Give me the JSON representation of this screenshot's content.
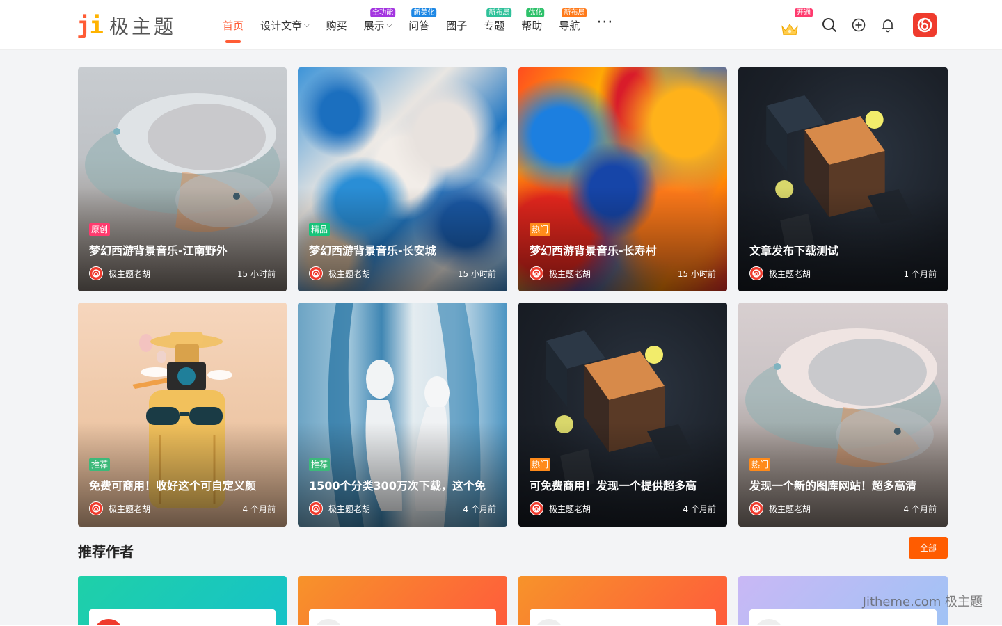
{
  "logo": {
    "mark_j": "j",
    "mark_i": "i",
    "text": "极主题"
  },
  "nav": {
    "items": [
      {
        "label": "首页",
        "active": true,
        "badge": "",
        "badge_color": ""
      },
      {
        "label": "设计文章",
        "active": false,
        "badge": "",
        "badge_color": "",
        "dropdown": true
      },
      {
        "label": "购买",
        "active": false,
        "badge": "",
        "badge_color": ""
      },
      {
        "label": "展示",
        "active": false,
        "badge": "全功能",
        "badge_color": "#a335e0",
        "dropdown": true
      },
      {
        "label": "问答",
        "active": false,
        "badge": "新美化",
        "badge_color": "#1e88e5"
      },
      {
        "label": "圈子",
        "active": false,
        "badge": "",
        "badge_color": ""
      },
      {
        "label": "专题",
        "active": false,
        "badge": "新布局",
        "badge_color": "#2ec19a"
      },
      {
        "label": "帮助",
        "active": false,
        "badge": "优化",
        "badge_color": "#2ec16a"
      },
      {
        "label": "导航",
        "active": false,
        "badge": "新布局",
        "badge_color": "#ff7a1a"
      }
    ],
    "more": "···"
  },
  "header_right": {
    "vip_badge": "开通"
  },
  "posts": [
    {
      "tag": "原创",
      "tag_color": "#ff3a6e",
      "title": "梦幻西游背景音乐-江南野外",
      "author": "极主题老胡",
      "time": "15 小时前",
      "img": "dome"
    },
    {
      "tag": "精品",
      "tag_color": "#17c37a",
      "title": "梦幻西游背景音乐-长安城",
      "author": "极主题老胡",
      "time": "15 小时前",
      "img": "marble"
    },
    {
      "tag": "热门",
      "tag_color": "#ff8a1a",
      "title": "梦幻西游背景音乐-长寿村",
      "author": "极主题老胡",
      "time": "15 小时前",
      "img": "fluid"
    },
    {
      "tag": "",
      "tag_color": "",
      "title": "文章发布下载测试",
      "author": "极主题老胡",
      "time": "1 个月前",
      "img": "cubes"
    },
    {
      "tag": "推荐",
      "tag_color": "#3cb97a",
      "title": "免费可商用！收好这个可自定义颜",
      "author": "极主题老胡",
      "time": "4 个月前",
      "img": "luggage"
    },
    {
      "tag": "推荐",
      "tag_color": "#3cb97a",
      "title": "1500个分类300万次下载，这个免",
      "author": "极主题老胡",
      "time": "4 个月前",
      "img": "water"
    },
    {
      "tag": "热门",
      "tag_color": "#ff8a1a",
      "title": "可免费商用！发现一个提供超多高",
      "author": "极主题老胡",
      "time": "4 个月前",
      "img": "cubes"
    },
    {
      "tag": "热门",
      "tag_color": "#ff8a1a",
      "title": "发现一个新的图库网站！超多高清",
      "author": "极主题老胡",
      "time": "4 个月前",
      "img": "dome2"
    }
  ],
  "authors_section": {
    "title": "推荐作者",
    "all_label": "全部",
    "cards": [
      {
        "gradient_from": "#1fd0a8",
        "gradient_to": "#16c2c9"
      },
      {
        "gradient_from": "#f7932a",
        "gradient_to": "#ff5a3c"
      },
      {
        "gradient_from": "#f7932a",
        "gradient_to": "#ff5a3c"
      },
      {
        "gradient_from": "#c9b8f5",
        "gradient_to": "#9fc3f5"
      }
    ]
  },
  "watermark": "Jitheme.com 极主题"
}
